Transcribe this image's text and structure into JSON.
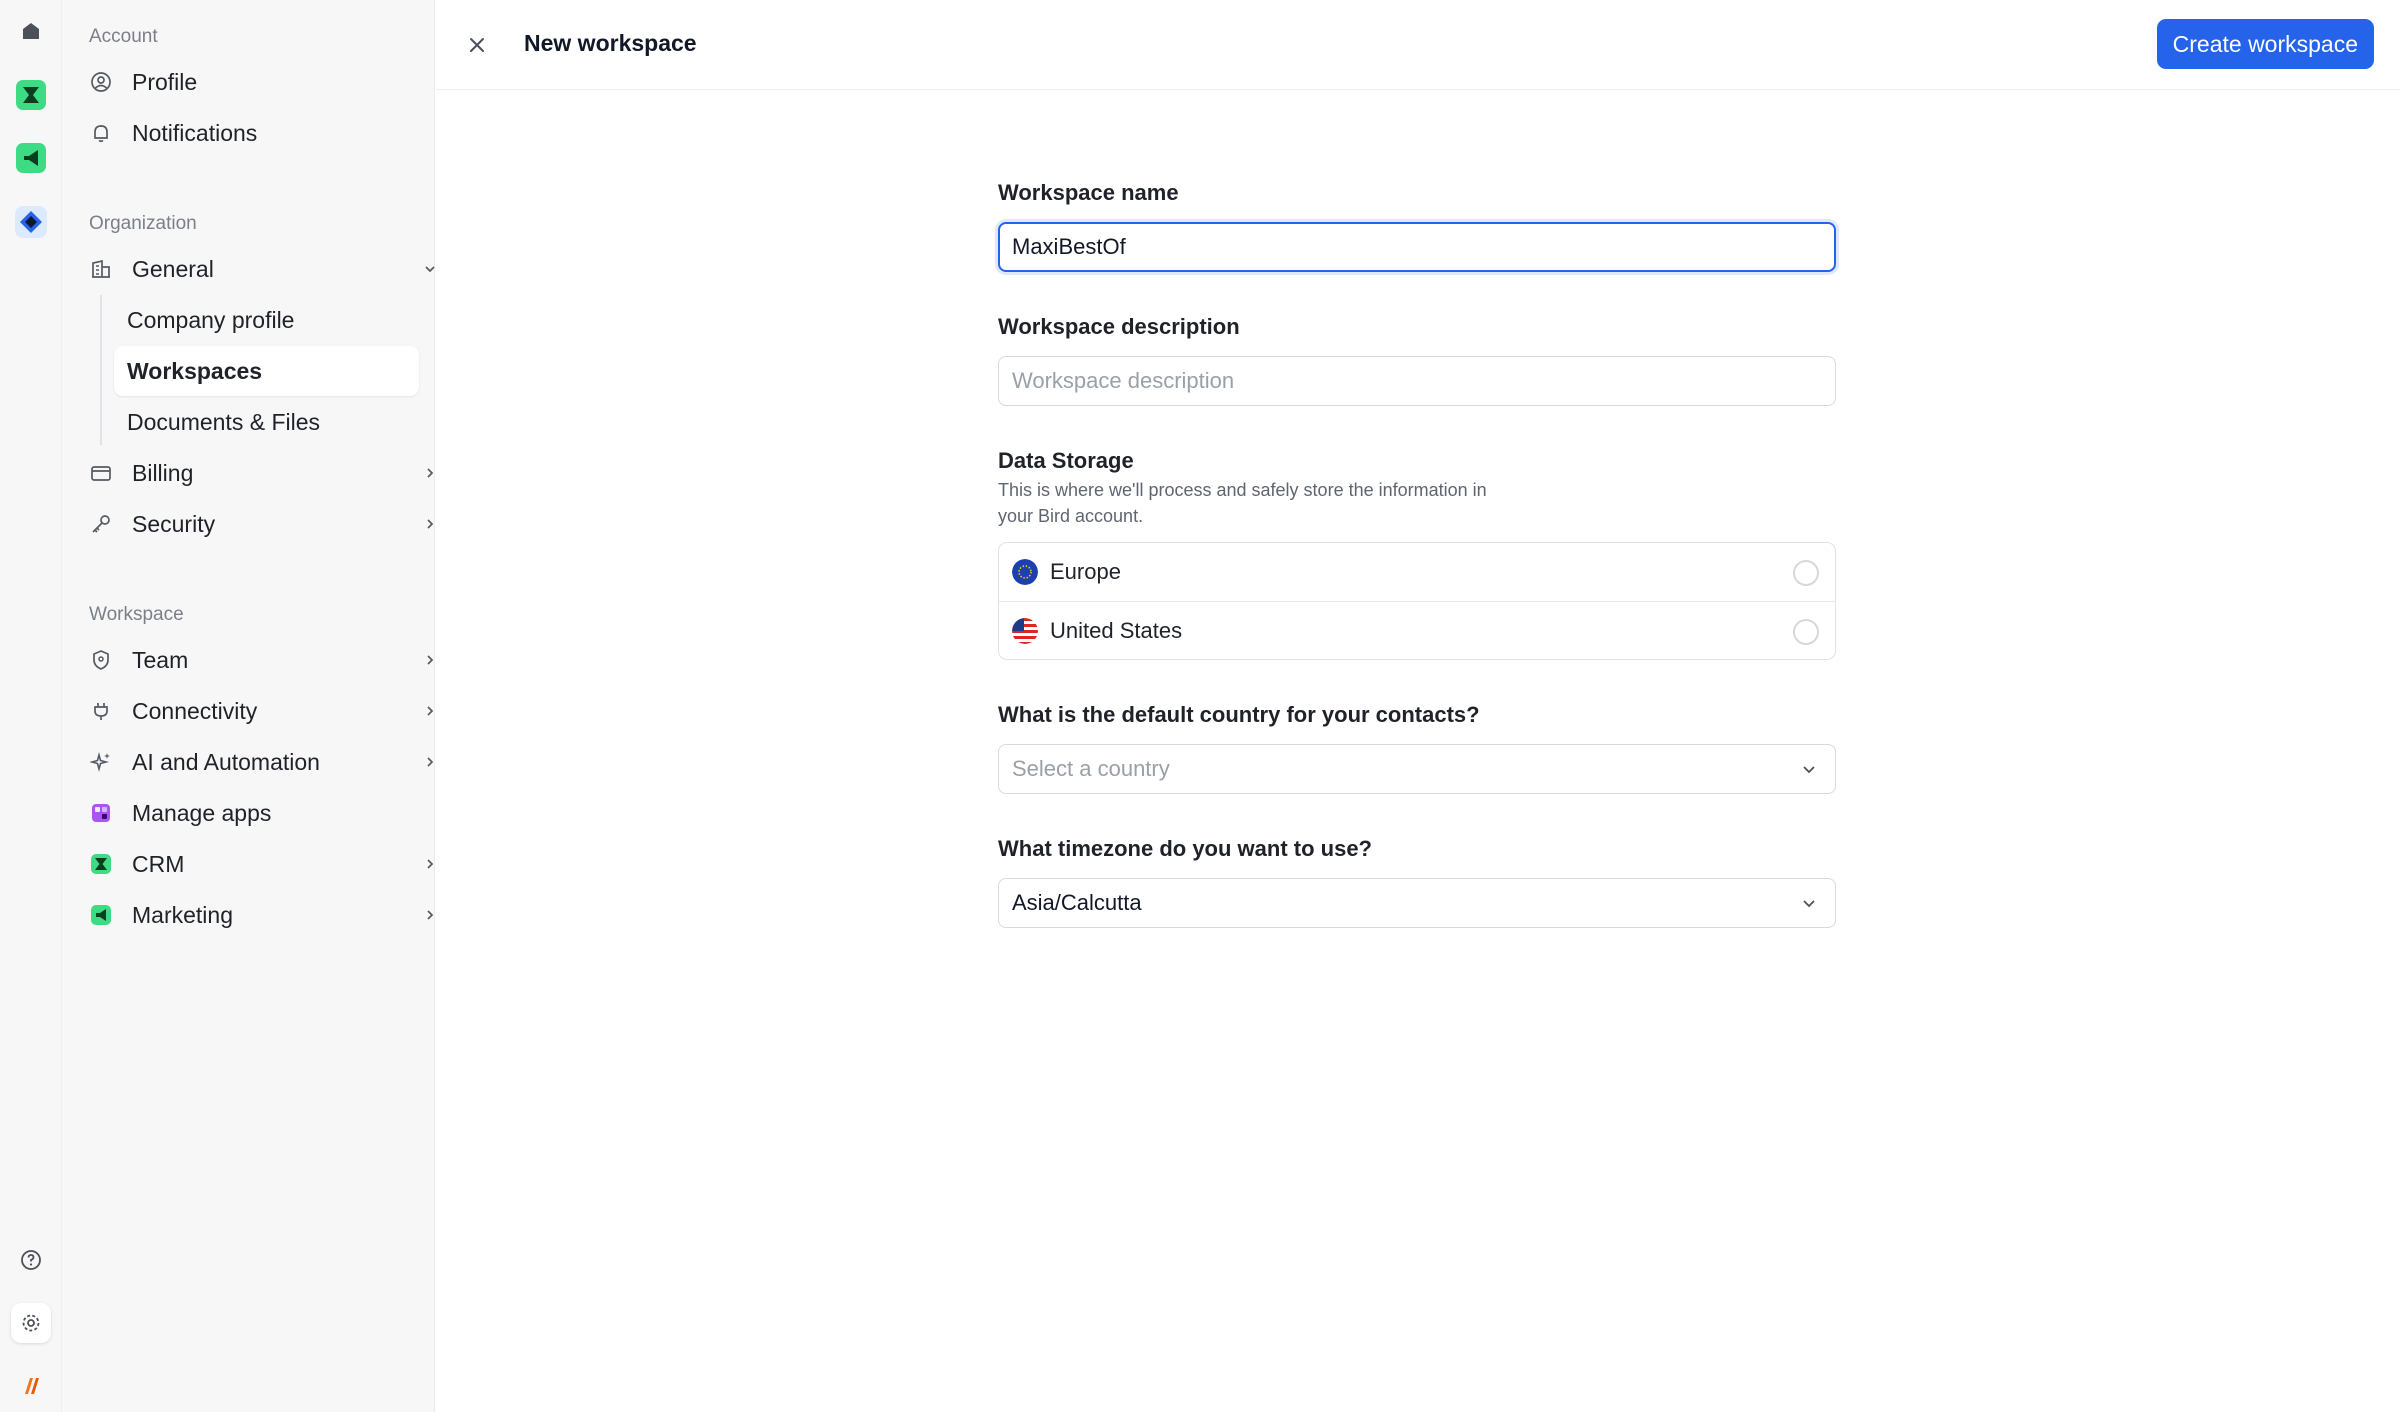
{
  "sidebar": {
    "account_label": "Account",
    "profile": "Profile",
    "notifications": "Notifications",
    "organization_label": "Organization",
    "general": "General",
    "company_profile": "Company profile",
    "workspaces": "Workspaces",
    "documents_files": "Documents & Files",
    "billing": "Billing",
    "security": "Security",
    "workspace_label": "Workspace",
    "team": "Team",
    "connectivity": "Connectivity",
    "ai_automation": "AI and Automation",
    "manage_apps": "Manage apps",
    "crm": "CRM",
    "marketing": "Marketing"
  },
  "header": {
    "title": "New workspace",
    "create_button": "Create workspace"
  },
  "form": {
    "name_label": "Workspace name",
    "name_value": "MaxiBestOf",
    "description_label": "Workspace description",
    "description_placeholder": "Workspace description",
    "storage_label": "Data Storage",
    "storage_help": "This is where we'll process and safely store the information in your Bird account.",
    "storage_options": [
      "Europe",
      "United States"
    ],
    "country_label": "What is the default country for your contacts?",
    "country_placeholder": "Select a country",
    "timezone_label": "What timezone do you want to use?",
    "timezone_value": "Asia/Calcutta"
  },
  "colors": {
    "accent": "#2563eb",
    "crm_green": "#22c55e",
    "brand_orange": "#f97316"
  }
}
